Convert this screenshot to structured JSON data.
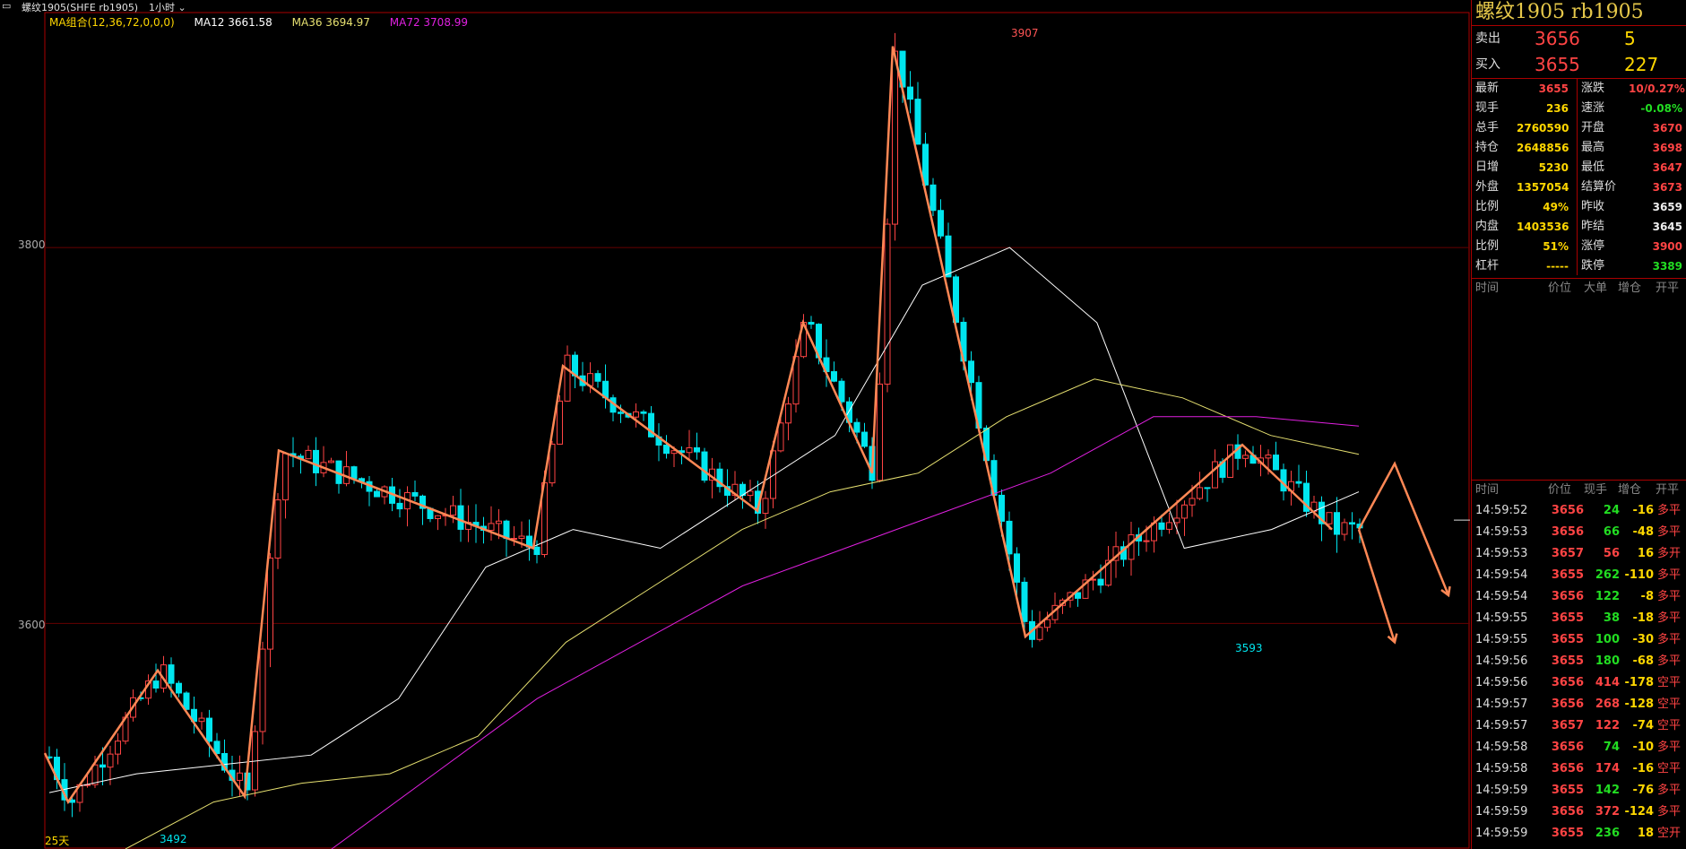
{
  "window": {
    "title": "螺纹1905(SHFE rb1905)",
    "period": "1小时",
    "legend": [
      {
        "label": "MA组合(12,36,72,0,0,0)",
        "color": "#ffd700"
      },
      {
        "label": "MA12 3661.58",
        "color": "#ffffff"
      },
      {
        "label": "MA36 3694.97",
        "color": "#e6e070"
      },
      {
        "label": "MA72 3708.99",
        "color": "#e020e0"
      }
    ]
  },
  "chart": {
    "y_labels": [
      "3800",
      "3600"
    ],
    "high_label": "3907",
    "low_label": "3593",
    "left_low_label": "3492",
    "days_label": "25天",
    "colors": {
      "up": "#ff4444",
      "down": "#00e5ee",
      "zigzag": "#ff8855",
      "ma12": "#ffffff",
      "ma36": "#e6e070",
      "ma72": "#e020e0"
    }
  },
  "chart_data": {
    "type": "candlestick",
    "ylim": [
      3480,
      3925
    ],
    "zigzag": [
      3531,
      3505,
      3575,
      3508,
      3692,
      3640,
      3737,
      3660,
      3760,
      3680,
      3907,
      3593,
      3695,
      3650
    ],
    "ma12": [
      3510,
      3520,
      3525,
      3530,
      3560,
      3630,
      3650,
      3640,
      3670,
      3700,
      3780,
      3800,
      3760,
      3640,
      3650,
      3670
    ],
    "ma36": [
      3480,
      3505,
      3515,
      3520,
      3540,
      3590,
      3620,
      3650,
      3670,
      3680,
      3710,
      3730,
      3720,
      3700,
      3690
    ],
    "ma72": [
      3480,
      3520,
      3560,
      3590,
      3620,
      3640,
      3660,
      3680,
      3710,
      3710,
      3705
    ]
  },
  "panel": {
    "title": "螺纹1905 rb1905",
    "ask": {
      "label": "卖出",
      "price": "3656",
      "vol": "5"
    },
    "bid": {
      "label": "买入",
      "price": "3655",
      "vol": "227"
    },
    "stats": [
      {
        "l1": "最新",
        "v1": "3655",
        "c1": "red",
        "l2": "涨跌",
        "v2": "10/0.27%",
        "c2": "red"
      },
      {
        "l1": "现手",
        "v1": "236",
        "c1": "yel",
        "l2": "速涨",
        "v2": "-0.08%",
        "c2": "grn"
      },
      {
        "l1": "总手",
        "v1": "2760590",
        "c1": "yel",
        "l2": "开盘",
        "v2": "3670",
        "c2": "red"
      },
      {
        "l1": "持仓",
        "v1": "2648856",
        "c1": "yel",
        "l2": "最高",
        "v2": "3698",
        "c2": "red"
      },
      {
        "l1": "日增",
        "v1": "5230",
        "c1": "yel",
        "l2": "最低",
        "v2": "3647",
        "c2": "red"
      },
      {
        "l1": "外盘",
        "v1": "1357054",
        "c1": "yel",
        "l2": "结算价",
        "v2": "3673",
        "c2": "red"
      },
      {
        "l1": "比例",
        "v1": "49%",
        "c1": "yel",
        "l2": "昨收",
        "v2": "3659",
        "c2": "wht"
      },
      {
        "l1": "内盘",
        "v1": "1403536",
        "c1": "yel",
        "l2": "昨结",
        "v2": "3645",
        "c2": "wht"
      },
      {
        "l1": "比例",
        "v1": "51%",
        "c1": "yel",
        "l2": "涨停",
        "v2": "3900",
        "c2": "red"
      },
      {
        "l1": "杠杆",
        "v1": "-----",
        "c1": "yel",
        "l2": "跌停",
        "v2": "3389",
        "c2": "grn"
      }
    ],
    "big_header": [
      "时间",
      "价位",
      "大单",
      "增仓",
      "开平"
    ],
    "tick_header": [
      "时间",
      "价位",
      "现手",
      "增仓",
      "开平"
    ],
    "ticks": [
      {
        "t": "14:59:52",
        "p": "3656",
        "v": "24",
        "vc": "grn",
        "d": "-16",
        "dc": "yel",
        "k": "多平"
      },
      {
        "t": "14:59:53",
        "p": "3656",
        "v": "66",
        "vc": "grn",
        "d": "-48",
        "dc": "yel",
        "k": "多平"
      },
      {
        "t": "14:59:53",
        "p": "3657",
        "v": "56",
        "vc": "red",
        "d": "16",
        "dc": "yel",
        "k": "多开"
      },
      {
        "t": "14:59:54",
        "p": "3655",
        "v": "262",
        "vc": "grn",
        "d": "-110",
        "dc": "yel",
        "k": "多平"
      },
      {
        "t": "14:59:54",
        "p": "3656",
        "v": "122",
        "vc": "grn",
        "d": "-8",
        "dc": "yel",
        "k": "多平"
      },
      {
        "t": "14:59:55",
        "p": "3655",
        "v": "38",
        "vc": "grn",
        "d": "-18",
        "dc": "yel",
        "k": "多平"
      },
      {
        "t": "14:59:55",
        "p": "3655",
        "v": "100",
        "vc": "grn",
        "d": "-30",
        "dc": "yel",
        "k": "多平"
      },
      {
        "t": "14:59:56",
        "p": "3655",
        "v": "180",
        "vc": "grn",
        "d": "-68",
        "dc": "yel",
        "k": "多平"
      },
      {
        "t": "14:59:56",
        "p": "3656",
        "v": "414",
        "vc": "red",
        "d": "-178",
        "dc": "yel",
        "k": "空平"
      },
      {
        "t": "14:59:57",
        "p": "3656",
        "v": "268",
        "vc": "red",
        "d": "-128",
        "dc": "yel",
        "k": "空平"
      },
      {
        "t": "14:59:57",
        "p": "3657",
        "v": "122",
        "vc": "red",
        "d": "-74",
        "dc": "yel",
        "k": "空平"
      },
      {
        "t": "14:59:58",
        "p": "3656",
        "v": "74",
        "vc": "grn",
        "d": "-10",
        "dc": "yel",
        "k": "多平"
      },
      {
        "t": "14:59:58",
        "p": "3656",
        "v": "174",
        "vc": "red",
        "d": "-16",
        "dc": "yel",
        "k": "空平"
      },
      {
        "t": "14:59:59",
        "p": "3655",
        "v": "142",
        "vc": "grn",
        "d": "-76",
        "dc": "yel",
        "k": "多平"
      },
      {
        "t": "14:59:59",
        "p": "3656",
        "v": "372",
        "vc": "red",
        "d": "-124",
        "dc": "yel",
        "k": "多平"
      },
      {
        "t": "14:59:59",
        "p": "3655",
        "v": "236",
        "vc": "grn",
        "d": "18",
        "dc": "yel",
        "k": "空开"
      }
    ]
  }
}
